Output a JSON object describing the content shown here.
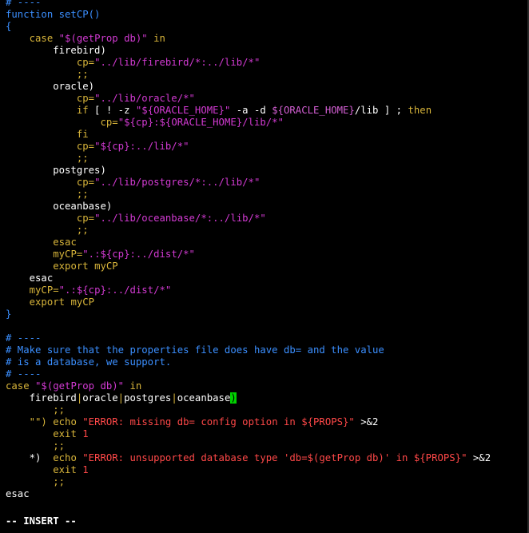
{
  "window": {
    "mode": "terminal vim editor"
  },
  "colors": {
    "default": "#ffffff",
    "comment": "#3b8fff",
    "keyword": "#d7b43a",
    "string": "#d23ad2",
    "special": "#d45fd4",
    "error": "#ff4848",
    "number": "#ff4848",
    "cursor_bg": "#00d200"
  },
  "editor": {
    "lines": [
      [
        [
          "# ----",
          "comment"
        ]
      ],
      [
        [
          "function setCP()",
          "comment"
        ]
      ],
      [
        [
          "{",
          "comment"
        ]
      ],
      [
        [
          "    ",
          ""
        ],
        [
          "case",
          "keyword"
        ],
        [
          " ",
          ""
        ],
        [
          "\"$(getProp db)\"",
          "string"
        ],
        [
          " in",
          "keyword"
        ]
      ],
      [
        [
          "        firebird)",
          ""
        ]
      ],
      [
        [
          "            ",
          ""
        ],
        [
          "cp=",
          "keyword"
        ],
        [
          "\"../lib/firebird/*:../lib/*\"",
          "string"
        ]
      ],
      [
        [
          "            ;;",
          "keyword"
        ]
      ],
      [
        [
          "        oracle)",
          ""
        ]
      ],
      [
        [
          "            ",
          ""
        ],
        [
          "cp=",
          "keyword"
        ],
        [
          "\"../lib/oracle/*\"",
          "string"
        ]
      ],
      [
        [
          "            ",
          ""
        ],
        [
          "if",
          "keyword"
        ],
        [
          " [ ! -z ",
          ""
        ],
        [
          "\"${ORACLE_HOME}\"",
          "string"
        ],
        [
          " -a -d ",
          ""
        ],
        [
          "${ORACLE_HOME}",
          "special"
        ],
        [
          "/lib ] ; ",
          ""
        ],
        [
          "then",
          "keyword"
        ]
      ],
      [
        [
          "                ",
          ""
        ],
        [
          "cp=",
          "keyword"
        ],
        [
          "\"${cp}:${ORACLE_HOME}/lib/*\"",
          "string"
        ]
      ],
      [
        [
          "            ",
          ""
        ],
        [
          "fi",
          "keyword"
        ]
      ],
      [
        [
          "            ",
          ""
        ],
        [
          "cp=",
          "keyword"
        ],
        [
          "\"${cp}:../lib/*\"",
          "string"
        ]
      ],
      [
        [
          "            ;;",
          "keyword"
        ]
      ],
      [
        [
          "        postgres)",
          ""
        ]
      ],
      [
        [
          "            ",
          ""
        ],
        [
          "cp=",
          "keyword"
        ],
        [
          "\"../lib/postgres/*:../lib/*\"",
          "string"
        ]
      ],
      [
        [
          "            ;;",
          "keyword"
        ]
      ],
      [
        [
          "        oceanbase)",
          ""
        ]
      ],
      [
        [
          "            ",
          ""
        ],
        [
          "cp=",
          "keyword"
        ],
        [
          "\"../lib/oceanbase/*:../lib/*\"",
          "string"
        ]
      ],
      [
        [
          "            ;;",
          "keyword"
        ]
      ],
      [
        [
          "        ",
          ""
        ],
        [
          "esac",
          "keyword"
        ]
      ],
      [
        [
          "        ",
          ""
        ],
        [
          "myCP=",
          "keyword"
        ],
        [
          "\".:${cp}:../dist/*\"",
          "string"
        ]
      ],
      [
        [
          "        ",
          ""
        ],
        [
          "export",
          "keyword"
        ],
        [
          " ",
          ""
        ],
        [
          "myCP",
          "keyword"
        ]
      ],
      [
        [
          "    esac",
          ""
        ]
      ],
      [
        [
          "    ",
          ""
        ],
        [
          "myCP=",
          "keyword"
        ],
        [
          "\".:${cp}:../dist/*\"",
          "string"
        ]
      ],
      [
        [
          "    ",
          ""
        ],
        [
          "export",
          "keyword"
        ],
        [
          " ",
          ""
        ],
        [
          "myCP",
          "keyword"
        ]
      ],
      [
        [
          "}",
          "comment"
        ]
      ],
      [
        [
          "",
          ""
        ]
      ],
      [
        [
          "# ----",
          "comment"
        ]
      ],
      [
        [
          "# Make sure that the properties file does have db= and the value",
          "comment"
        ]
      ],
      [
        [
          "# is a database, we support.",
          "comment"
        ]
      ],
      [
        [
          "# ----",
          "comment"
        ]
      ],
      [
        [
          "case",
          "keyword"
        ],
        [
          " ",
          ""
        ],
        [
          "\"$(getProp db)\"",
          "string"
        ],
        [
          " in",
          "keyword"
        ]
      ],
      [
        [
          "    firebird",
          ""
        ],
        [
          "|",
          "keyword"
        ],
        [
          "oracle",
          ""
        ],
        [
          "|",
          "keyword"
        ],
        [
          "postgres",
          ""
        ],
        [
          "|",
          "keyword"
        ],
        [
          "oceanbase",
          ""
        ],
        [
          ")",
          "cursor"
        ]
      ],
      [
        [
          "        ;;",
          "keyword"
        ]
      ],
      [
        [
          "    ",
          ""
        ],
        [
          "\"\")",
          "keyword"
        ],
        [
          " ",
          ""
        ],
        [
          "echo",
          "keyword"
        ],
        [
          " ",
          ""
        ],
        [
          "\"ERROR: missing db= config option in ${PROPS}\"",
          "error"
        ],
        [
          " >&2",
          ""
        ]
      ],
      [
        [
          "        ",
          ""
        ],
        [
          "exit",
          "keyword"
        ],
        [
          " ",
          ""
        ],
        [
          "1",
          "number"
        ]
      ],
      [
        [
          "        ;;",
          "keyword"
        ]
      ],
      [
        [
          "    *)  ",
          ""
        ],
        [
          "echo",
          "keyword"
        ],
        [
          " ",
          ""
        ],
        [
          "\"ERROR: unsupported database type 'db=$(getProp db)' in ${PROPS}\"",
          "error"
        ],
        [
          " >&2",
          ""
        ]
      ],
      [
        [
          "        ",
          ""
        ],
        [
          "exit",
          "keyword"
        ],
        [
          " ",
          ""
        ],
        [
          "1",
          "number"
        ]
      ],
      [
        [
          "        ;;",
          "keyword"
        ]
      ],
      [
        [
          "esac",
          ""
        ]
      ]
    ],
    "status_line": "-- INSERT --"
  }
}
